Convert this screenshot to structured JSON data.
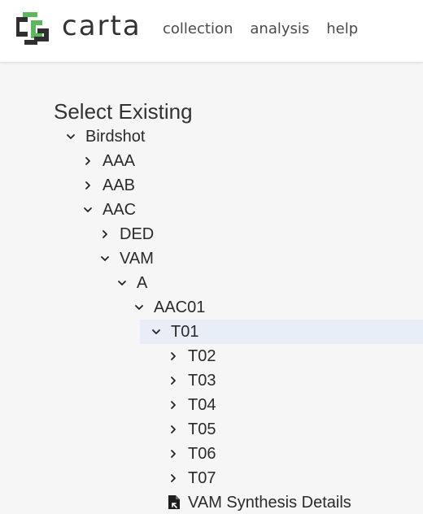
{
  "brand": {
    "name": "carta",
    "logo_icon": "carta-logo-icon",
    "accent": "#5bb85c",
    "ink": "#2f2f2f"
  },
  "nav": {
    "items": [
      "collection",
      "analysis",
      "help"
    ]
  },
  "main": {
    "title": "Select Existing",
    "selection_color": "#e7eef7",
    "tree": [
      {
        "label": "Birdshot",
        "level": 0,
        "state": "expanded"
      },
      {
        "label": "AAA",
        "level": 1,
        "state": "collapsed"
      },
      {
        "label": "AAB",
        "level": 1,
        "state": "collapsed"
      },
      {
        "label": "AAC",
        "level": 1,
        "state": "expanded"
      },
      {
        "label": "DED",
        "level": 2,
        "state": "collapsed"
      },
      {
        "label": "VAM",
        "level": 2,
        "state": "expanded"
      },
      {
        "label": "A",
        "level": 3,
        "state": "expanded"
      },
      {
        "label": "AAC01",
        "level": 4,
        "state": "expanded"
      },
      {
        "label": "T01",
        "level": 5,
        "state": "expanded",
        "selected": true
      },
      {
        "label": "T02",
        "level": 6,
        "state": "collapsed"
      },
      {
        "label": "T03",
        "level": 6,
        "state": "collapsed"
      },
      {
        "label": "T04",
        "level": 6,
        "state": "collapsed"
      },
      {
        "label": "T05",
        "level": 6,
        "state": "collapsed"
      },
      {
        "label": "T06",
        "level": 6,
        "state": "collapsed"
      },
      {
        "label": "T07",
        "level": 6,
        "state": "collapsed"
      },
      {
        "label": "VAM Synthesis Details",
        "level": 6,
        "state": "file",
        "icon": "file-link-icon"
      }
    ]
  }
}
